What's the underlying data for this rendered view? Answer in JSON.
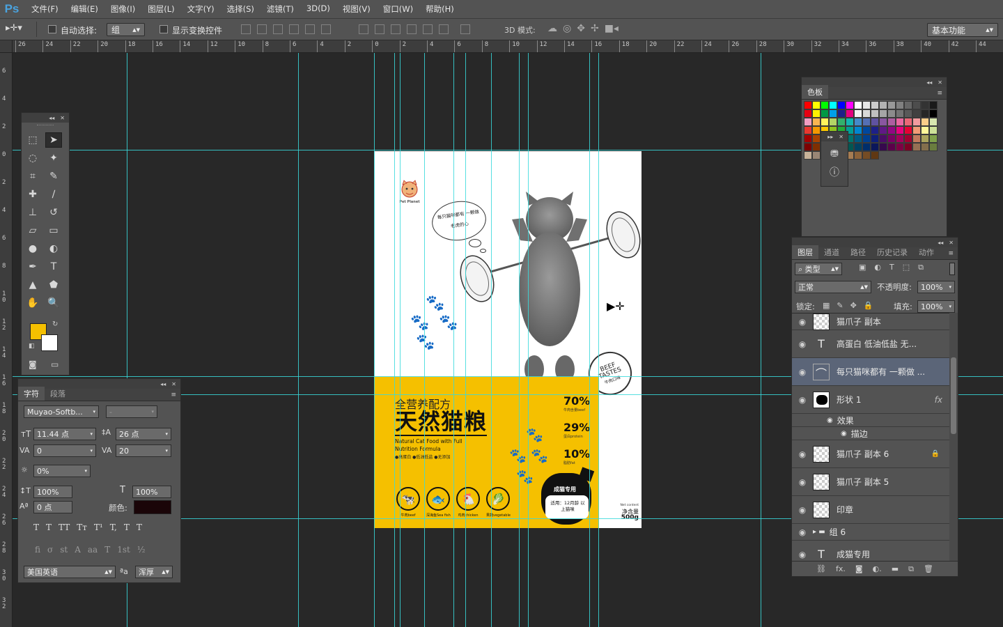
{
  "app": {
    "logo": "Ps"
  },
  "menu": [
    "文件(F)",
    "编辑(E)",
    "图像(I)",
    "图层(L)",
    "文字(Y)",
    "选择(S)",
    "滤镜(T)",
    "3D(D)",
    "视图(V)",
    "窗口(W)",
    "帮助(H)"
  ],
  "options": {
    "auto_select_label": "自动选择:",
    "auto_select_value": "组",
    "show_transform_label": "显示变换控件",
    "mode3d_label": "3D 模式:",
    "workspace": "基本功能"
  },
  "ruler_top": [
    "26",
    "24",
    "22",
    "20",
    "18",
    "16",
    "14",
    "12",
    "10",
    "8",
    "6",
    "4",
    "2",
    "0",
    "2",
    "4",
    "6",
    "8",
    "10",
    "12",
    "14",
    "16",
    "18",
    "20",
    "22",
    "24",
    "26",
    "28",
    "30",
    "32",
    "34",
    "36",
    "38",
    "40",
    "42",
    "44"
  ],
  "ruler_left": [
    "6",
    "4",
    "2",
    "0",
    "2",
    "4",
    "6",
    "8",
    "1\n0",
    "1\n2",
    "1\n4",
    "1\n6",
    "1\n8",
    "2\n0",
    "2\n2",
    "2\n4",
    "2\n6",
    "2\n8",
    "3\n0",
    "3\n2"
  ],
  "swatches_panel": {
    "title": "色板"
  },
  "swatch_colors": [
    [
      "#ff0000",
      "#ffff00",
      "#00ff00",
      "#00ffff",
      "#0000ff",
      "#ff00ff",
      "#ffffff",
      "#e6e6e6",
      "#cccccc",
      "#b3b3b3",
      "#999999",
      "#808080",
      "#666666",
      "#4d4d4d",
      "#333333",
      "#1a1a1a"
    ],
    [
      "#e60012",
      "#fff100",
      "#009944",
      "#00a0e9",
      "#1d2088",
      "#e4007f",
      "#f2f2f2",
      "#d9d9d9",
      "#bfbfbf",
      "#a6a6a6",
      "#8c8c8c",
      "#737373",
      "#595959",
      "#404040",
      "#262626",
      "#000000"
    ],
    [
      "#f19ec2",
      "#f8b551",
      "#fff45c",
      "#b3d465",
      "#32b16c",
      "#13b5b1",
      "#448aca",
      "#556fb5",
      "#5f52a0",
      "#8957a1",
      "#ae5da1",
      "#ea68a2",
      "#eb6877",
      "#f29c9f",
      "#facd89",
      "#d7e7af"
    ],
    [
      "#e8382f",
      "#f39800",
      "#fcc800",
      "#8fc31f",
      "#22ac38",
      "#009e96",
      "#0086d1",
      "#00479d",
      "#1d2088",
      "#601986",
      "#920783",
      "#e5007f",
      "#e60033",
      "#f29b76",
      "#fff799",
      "#cce198"
    ],
    [
      "#a40000",
      "#a84200",
      "#a57e00",
      "#5b7e00",
      "#007130",
      "#00736d",
      "#005982",
      "#003f8e",
      "#0f1f79",
      "#4a0d67",
      "#7a0063",
      "#a4005b",
      "#a20031",
      "#c27a5d",
      "#aaa45c",
      "#7fa14b"
    ],
    [
      "#7d0000",
      "#7f2f00",
      "#7f5e00",
      "#445f00",
      "#005424",
      "#005752",
      "#004162",
      "#002e6b",
      "#0b175b",
      "#36094d",
      "#5b004a",
      "#7d0044",
      "#7c0024",
      "#967054",
      "#836e4c",
      "#6a7d3f"
    ],
    [
      "#c7b299",
      "#998675",
      "#736357",
      "#534741",
      "#c69c6d",
      "#a67c52",
      "#8c6239",
      "#754c24",
      "#603813"
    ]
  ],
  "tools": {
    "rows": [
      [
        "marquee-icon",
        "move-icon"
      ],
      [
        "lasso-icon",
        "magic-wand-icon"
      ],
      [
        "crop-icon",
        "eyedropper-icon"
      ],
      [
        "healing-icon",
        "brush-icon"
      ],
      [
        "stamp-icon",
        "history-brush-icon"
      ],
      [
        "eraser-icon",
        "gradient-icon"
      ],
      [
        "blur-icon",
        "dodge-icon"
      ],
      [
        "pen-icon",
        "type-icon"
      ],
      [
        "path-select-icon",
        "shape-icon"
      ],
      [
        "hand-icon",
        "zoom-icon"
      ]
    ],
    "glyphs": [
      "⬚",
      "➤",
      "◌",
      "✦",
      "⌗",
      "✎",
      "✚",
      "∕",
      "⊥",
      "↺",
      "▱",
      "▭",
      "●",
      "◐",
      "✒",
      "T",
      "▲",
      "⬟",
      "✋",
      "🔍"
    ],
    "foreground": "#f5c000",
    "background": "#ffffff"
  },
  "character_panel": {
    "tabs": [
      "字符",
      "段落"
    ],
    "font_family": "Muyao-Softb...",
    "font_style": "-",
    "font_size": "11.44 点",
    "leading": "26 点",
    "kerning": "0",
    "tracking": "20",
    "tsume": "0%",
    "vscale": "100%",
    "hscale": "100%",
    "baseline": "0 点",
    "color_label": "颜色:",
    "color": "#1a0508",
    "language": "美国英语",
    "aa_label": "ªa",
    "antialias": "浑厚",
    "style_buttons_1": [
      "T",
      "T",
      "TT",
      "Tт",
      "T¹",
      "T,",
      "T",
      "T"
    ],
    "style_buttons_2": [
      "fi",
      "σ",
      "st",
      "A",
      "aa",
      "T",
      "1st",
      "½"
    ]
  },
  "layers_panel": {
    "tabs": [
      "图层",
      "通道",
      "路径",
      "历史记录",
      "动作"
    ],
    "filter": "类型",
    "blend": "正常",
    "opacity_label": "不透明度:",
    "opacity": "100%",
    "lock_label": "锁定:",
    "fill_label": "填充:",
    "fill": "100%",
    "layers": [
      {
        "name": "猫爪子 副本",
        "kind": "raster",
        "partial": true
      },
      {
        "name": "高蛋白  低油低盐  无...",
        "kind": "text"
      },
      {
        "name": "每只猫咪都有 一颗做 ...",
        "kind": "text-warp",
        "selected": true
      },
      {
        "name": "形状 1",
        "kind": "shape",
        "fx": "fx"
      },
      {
        "name": "效果",
        "kind": "effect"
      },
      {
        "name": "描边",
        "kind": "effect-item"
      },
      {
        "name": "猫爪子 副本 6",
        "kind": "raster",
        "locked": true
      },
      {
        "name": "猫爪子 副本 5",
        "kind": "raster"
      },
      {
        "name": "印章",
        "kind": "raster"
      },
      {
        "name": "组 6",
        "kind": "group"
      },
      {
        "name": "成猫专用",
        "kind": "text"
      }
    ]
  },
  "poster": {
    "brand": "Pet Planet",
    "bubble": "每只猫咪都有 一颗做老虎的心",
    "stamp_lines": [
      "BEEF",
      "TASTES",
      "牛肉口味"
    ],
    "headline_small": "全营养配方",
    "headline_big": "天然猫粮",
    "english": "Natural Cat Food with Full Nutrition Formula",
    "bullets": "●高蛋白 ●低油低盐 ●无添加",
    "stats": [
      {
        "value": "70%",
        "label": "牛肉含量beef"
      },
      {
        "value": "29%",
        "label": "蛋白protein"
      },
      {
        "value": "10%",
        "label": "脂肪fat"
      }
    ],
    "icons": [
      "牛肉beef",
      "深海鱼Sea fish",
      "鸡肉chicken",
      "果蔬vegetable"
    ],
    "badge_title": "成猫专用",
    "badge_text": "适用：12月龄 以上猫咪",
    "net_label": "Net content",
    "net_cn": "净含量",
    "net_value": "500g",
    "colors": {
      "yellow": "#f5c000",
      "black": "#111111"
    }
  }
}
